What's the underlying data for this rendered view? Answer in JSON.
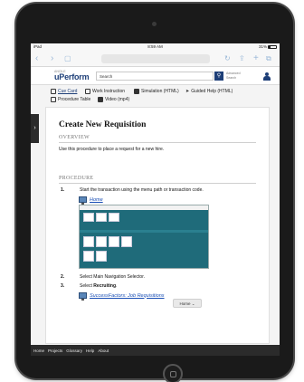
{
  "status": {
    "carrier": "iPad",
    "time": "8:59 AM",
    "battery": "31%"
  },
  "header": {
    "brand_small": "ANCILE",
    "brand": "uPerform",
    "search_value": "Search",
    "advanced_search": "Advanced Search"
  },
  "formats": [
    {
      "label": "Cue Card"
    },
    {
      "label": "Work Instruction"
    },
    {
      "label": "Simulation (HTML)"
    },
    {
      "label": "Guided Help (HTML)"
    },
    {
      "label": "Procedure Table"
    },
    {
      "label": "Video (mp4)"
    }
  ],
  "doc": {
    "title": "Create New Requisition",
    "overview_heading": "OVERVIEW",
    "overview_text": "Use this procedure to place a request for a new hire.",
    "procedure_heading": "PROCEDURE",
    "steps": [
      {
        "num": "1.",
        "text": "Start the transaction using the menu path or transaction code."
      },
      {
        "num": "2.",
        "text": "Select Main Navigation Selector."
      },
      {
        "num": "3.",
        "text_prefix": "Select ",
        "text_bold": "Recruiting",
        "text_suffix": "."
      }
    ],
    "link_home": "Home",
    "home_chip": "Home ⌄",
    "link_recruiting": "SuccessFactors: Job Requisitions"
  },
  "footer": {
    "links": [
      "Home",
      "Projects",
      "Glossary",
      "Help",
      "About"
    ]
  },
  "colors": {
    "brand": "#1e3f78",
    "link": "#1a4fb5",
    "footer": "#2b2b2b"
  }
}
